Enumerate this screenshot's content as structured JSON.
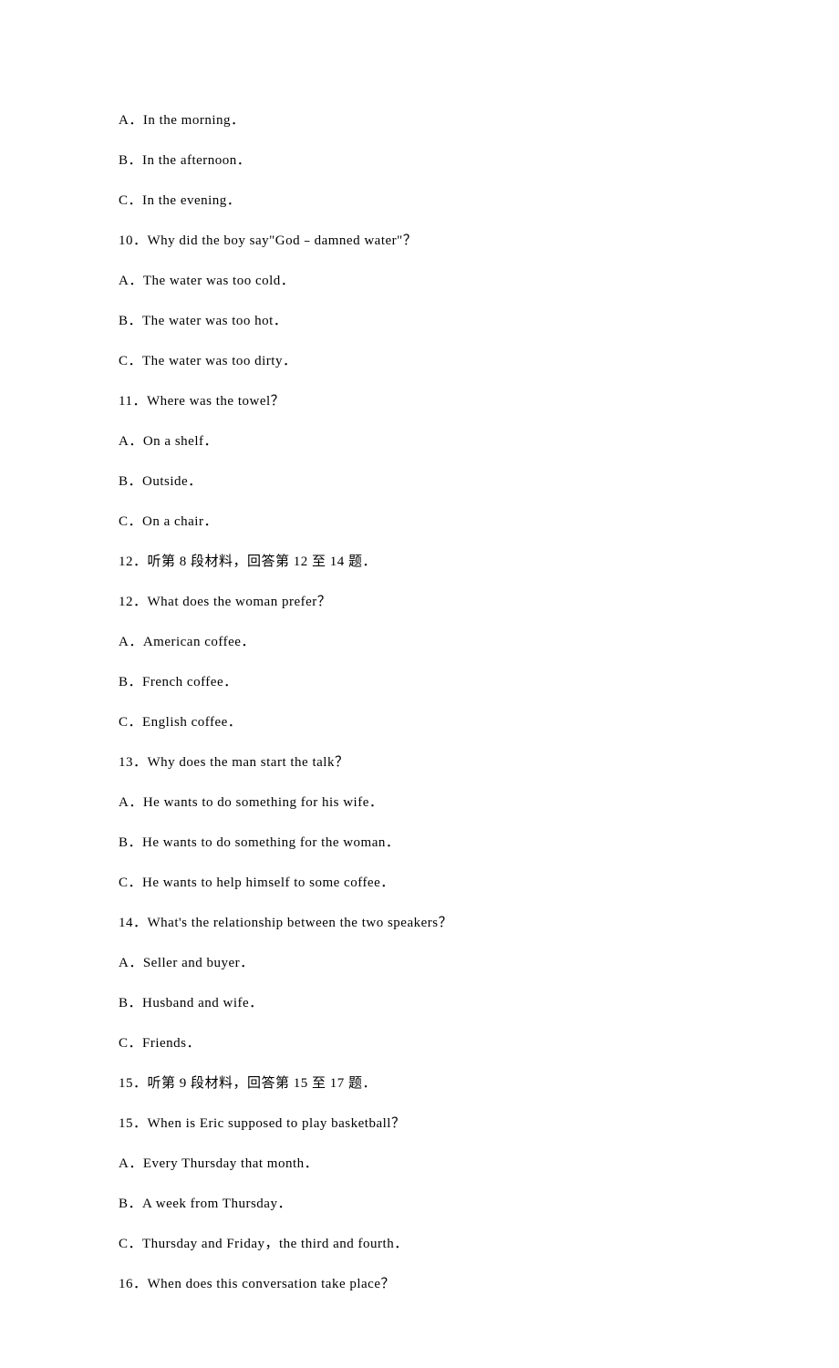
{
  "lines": [
    "A．In the morning．",
    "B．In the afternoon．",
    "C．In the evening．",
    "10．Why did the boy say\"God﹣damned water\"？",
    "A．The water was too cold．",
    "B．The water was too hot．",
    "C．The water was too dirty．",
    "11．Where was the towel？",
    "A．On a shelf．",
    "B．Outside．",
    "C．On a chair．",
    "12．听第 8 段材料，回答第 12 至 14 题．",
    "12．What does the woman prefer？",
    "A．American coffee．",
    "B．French coffee．",
    "C．English coffee．",
    "13．Why does the man start the talk？",
    "A．He wants to do something for his wife．",
    "B．He wants to do something for the woman．",
    "C．He wants to help himself to some coffee．",
    "14．What's the relationship between the two speakers？",
    "A．Seller and buyer．",
    "B．Husband and wife．",
    "C．Friends．",
    "15．听第 9 段材料，回答第 15 至 17 题．",
    "15．When is Eric supposed to play basketball？",
    "A．Every Thursday that month．",
    "B．A week from Thursday．",
    "C．Thursday and Friday，the third and fourth．",
    "16．When does this conversation take place？"
  ]
}
